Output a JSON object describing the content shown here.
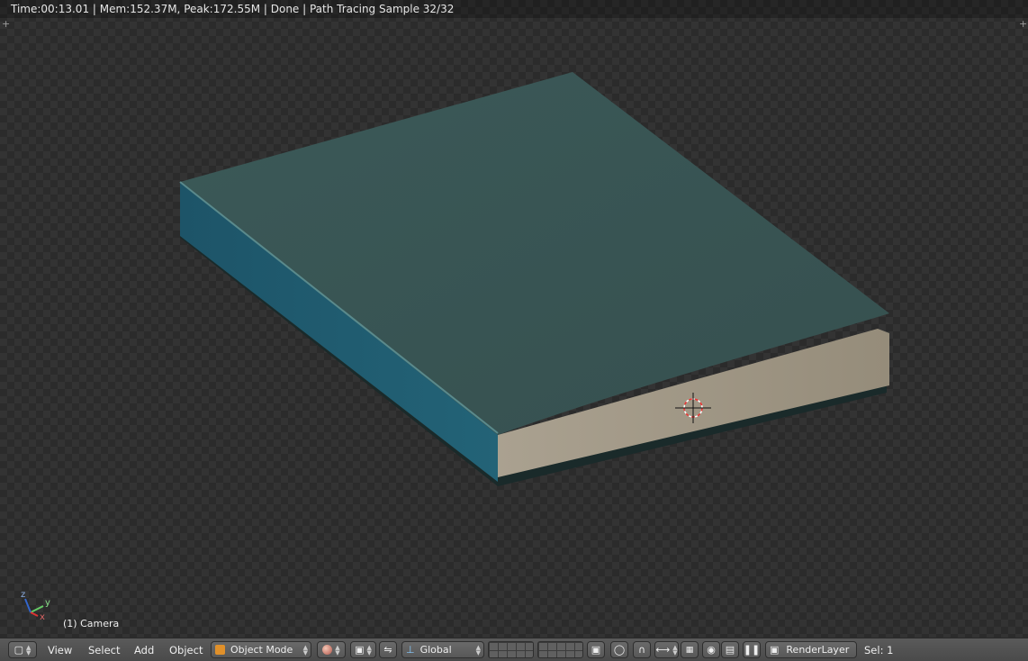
{
  "status_bar": {
    "text": "Time:00:13.01 | Mem:152.37M, Peak:172.55M | Done | Path Tracing Sample 32/32"
  },
  "viewport": {
    "object_label": "(1) Camera",
    "axes": {
      "x": "x",
      "y": "y",
      "z": "z"
    }
  },
  "header": {
    "menus": [
      "View",
      "Select",
      "Add",
      "Object"
    ],
    "mode": "Object Mode",
    "orientation": "Global",
    "render_layer": "RenderLayer",
    "selection": "Sel: 1"
  },
  "icons": {
    "editor_type": "cube-editor-icon",
    "shading": "sphere-shading-icon",
    "pivot": "pivot-point-icon",
    "manipulator": "manipulator-icon",
    "transform": "transform-axis-icon",
    "layers": "layer-grid-icon",
    "lock": "lock-icon",
    "proportional": "proportional-edit-icon",
    "snap": "magnet-snap-icon",
    "snap_element": "snap-element-icon",
    "render": "render-camera-icon",
    "render_anim": "clapperboard-icon",
    "pause": "pause-icon",
    "render_layer": "render-layer-icon"
  },
  "colors": {
    "book_cover": "#3d5a59",
    "book_spine": "#1f5a6d",
    "pages": "#a39a88"
  }
}
